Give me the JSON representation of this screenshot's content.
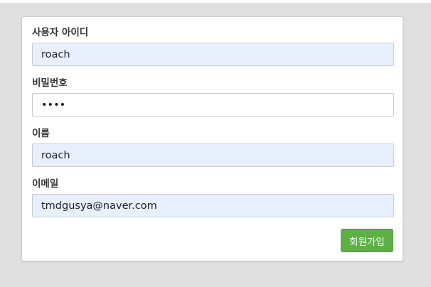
{
  "form": {
    "username": {
      "label": "사용자 아이디",
      "value": "roach"
    },
    "password": {
      "label": "비밀번호",
      "value": "••••"
    },
    "name": {
      "label": "이름",
      "value": "roach"
    },
    "email": {
      "label": "이메일",
      "value": "tmdgusya@naver.com"
    },
    "submit_label": "회원가입"
  },
  "colors": {
    "background": "#e0e0e0",
    "card": "#ffffff",
    "autofill": "#e8f0fe",
    "submit": "#5cb046"
  }
}
